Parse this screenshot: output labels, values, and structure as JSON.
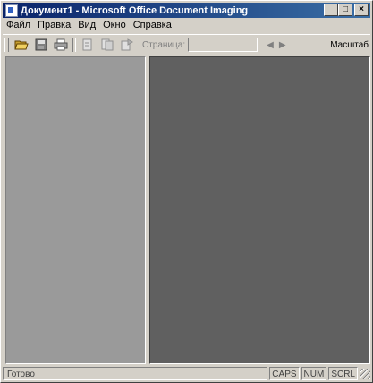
{
  "window": {
    "title": "Документ1 - Microsoft Office Document Imaging",
    "minimize": "_",
    "maximize": "□",
    "close": "×"
  },
  "menu": [
    {
      "label": "Файл"
    },
    {
      "label": "Правка"
    },
    {
      "label": "Вид"
    },
    {
      "label": "Окно"
    },
    {
      "label": "Справка"
    }
  ],
  "toolbar": {
    "icons": [
      "open-folder-icon",
      "save-icon",
      "print-icon",
      "select-page-icon",
      "rotate-page-icon",
      "insert-page-icon"
    ],
    "page_label": "Страница:",
    "page_value": "",
    "prev_glyph": "◀",
    "next_glyph": "▶",
    "zoom_label": "Масштаб"
  },
  "status": {
    "text": "Готово",
    "caps": "CAPS",
    "num": "NUM",
    "scrl": "SCRL"
  },
  "colors": {
    "title_start": "#0a246a",
    "title_end": "#3a6ea5",
    "thumb_pane": "#9a9a9a",
    "page_pane": "#606060",
    "chrome": "#d4d0c8"
  }
}
